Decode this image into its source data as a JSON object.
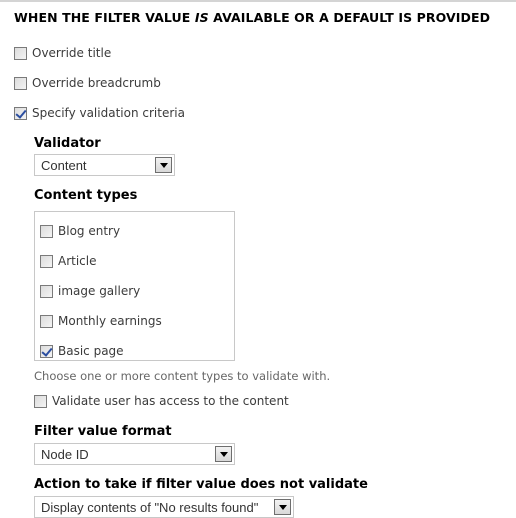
{
  "section": {
    "title_before": "WHEN THE FILTER VALUE ",
    "title_emph": "IS",
    "title_after": " AVAILABLE OR A DEFAULT IS PROVIDED"
  },
  "options": [
    {
      "label": "Override title",
      "checked": false
    },
    {
      "label": "Override breadcrumb",
      "checked": false
    },
    {
      "label": "Specify validation criteria",
      "checked": true
    }
  ],
  "validator": {
    "label": "Validator",
    "value": "Content"
  },
  "content_types": {
    "label": "Content types",
    "items": [
      {
        "label": "Blog entry",
        "checked": false
      },
      {
        "label": "Article",
        "checked": false
      },
      {
        "label": "image gallery",
        "checked": false
      },
      {
        "label": "Monthly earnings",
        "checked": false
      },
      {
        "label": "Basic page",
        "checked": true
      }
    ],
    "description": "Choose one or more content types to validate with."
  },
  "access": {
    "label": "Validate user has access to the content",
    "checked": false
  },
  "filter_format": {
    "label": "Filter value format",
    "value": "Node ID"
  },
  "fail_action": {
    "label": "Action to take if filter value does not validate",
    "value": "Display contents of \"No results found\""
  }
}
